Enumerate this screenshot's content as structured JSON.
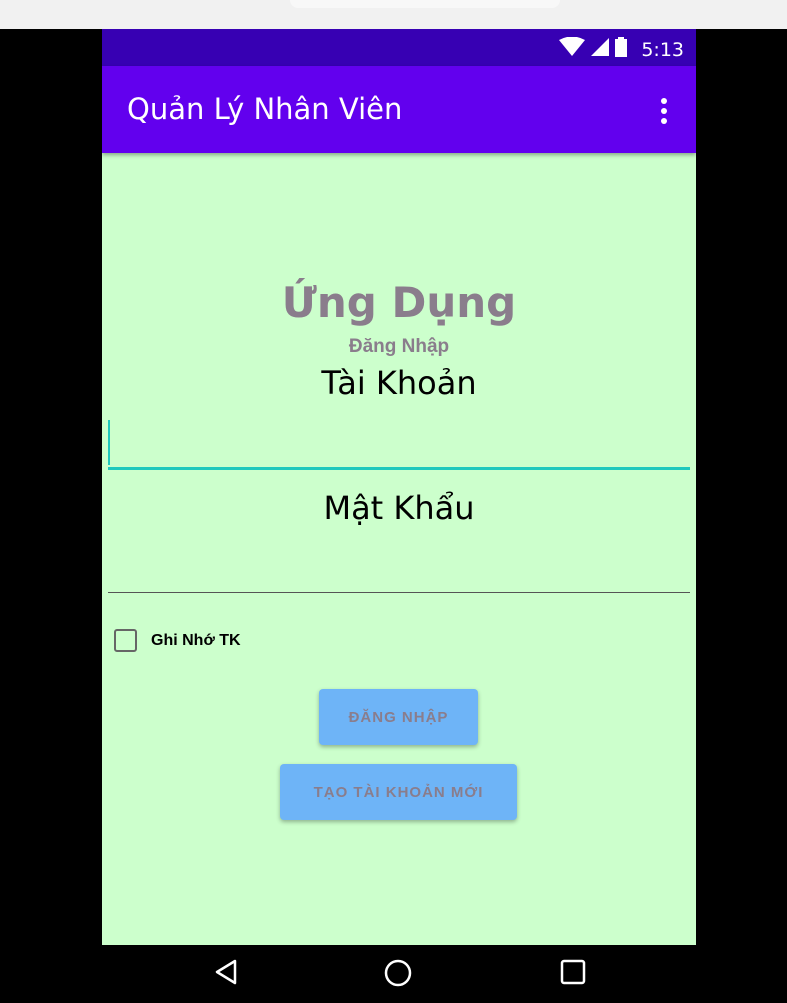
{
  "status_bar": {
    "time": "5:13",
    "icons": [
      "wifi-icon",
      "signal-icon",
      "battery-icon"
    ]
  },
  "app_bar": {
    "title": "Quản Lý Nhân Viên",
    "menu_icon": "more-vert-icon"
  },
  "login_form": {
    "app_heading": "Ứng Dụng",
    "app_subheading": "Đăng Nhập",
    "username_label": "Tài Khoản",
    "username_value": "",
    "password_label": "Mật Khẩu",
    "password_value": "",
    "remember_label": "Ghi Nhớ TK",
    "remember_checked": false,
    "login_button": "ĐĂNG NHẬP",
    "create_account_button": "TẠO TÀI KHOẢN MỚI"
  },
  "navigation": {
    "buttons": [
      "back-icon",
      "home-icon",
      "recents-icon"
    ]
  },
  "colors": {
    "status_bar": "#3700b3",
    "app_bar": "#6200ee",
    "background": "#ccffcc",
    "button": "#6eb4f7",
    "accent": "#1fc8bd",
    "heading_text": "#8a7d8c"
  }
}
